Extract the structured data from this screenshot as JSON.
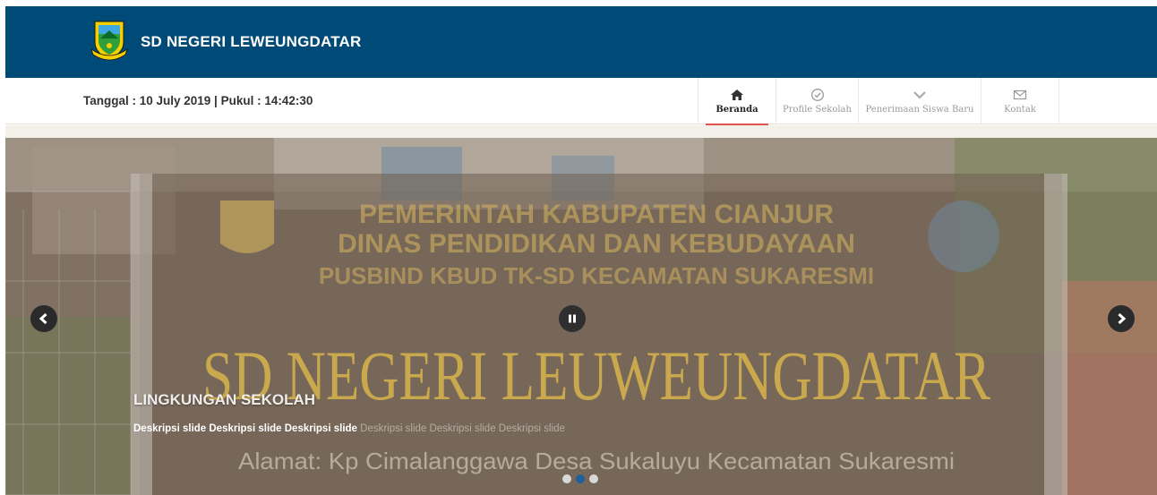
{
  "header": {
    "site_title": "SD NEGERI LEWEUNGDATAR",
    "logo_icon": "cianjur-regency-crest-logo",
    "bg_color": "#004a77"
  },
  "subbar": {
    "datetime": "Tanggal : 10 July 2019 | Pukul : 14:42:30"
  },
  "nav": {
    "items": [
      {
        "label": "Beranda",
        "icon": "home-icon",
        "active": true
      },
      {
        "label": "Profile Sekolah",
        "icon": "check-circle-icon",
        "active": false
      },
      {
        "label": "Penerimaan Siswa Baru",
        "icon": "chevron-down-icon",
        "active": false
      },
      {
        "label": "Kontak",
        "icon": "envelope-icon",
        "active": false
      }
    ],
    "active_underline_color": "#e0544e"
  },
  "slider": {
    "caption_title": "LINGKUNGAN SEKOLAH",
    "caption_desc_bold": "Deskripsi slide Deskripsi slide Deskripsi slide",
    "caption_desc_faded": "Deskripsi slide Deskripsi slide Deskripsi slide",
    "photo_sign": {
      "line1": "PEMERINTAH KABUPATEN CIANJUR",
      "line2": "DINAS PENDIDIKAN DAN KEBUDAYAAN",
      "line3": "PUSBIND KBUD TK-SD KECAMATAN SUKARESMI",
      "main": "SD NEGERI LEUWEUNGDATAR",
      "address": "Alamat: Kp Cimalanggawa Desa Sukaluyu Kecamatan Sukaresmi"
    },
    "dots_count": 3,
    "active_dot_index": 1,
    "controls": {
      "prev": "chevron-left-icon",
      "next": "chevron-right-icon",
      "pause": "pause-icon"
    }
  }
}
